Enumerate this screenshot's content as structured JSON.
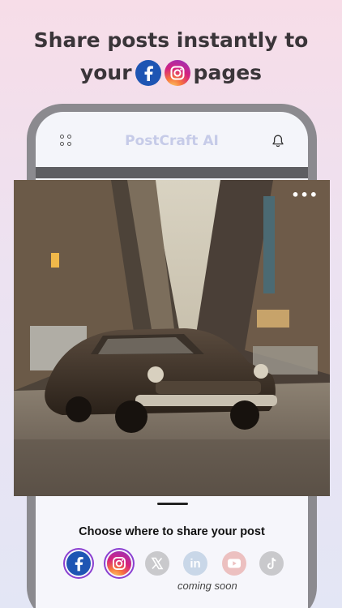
{
  "headline": {
    "line1": "Share posts instantly to",
    "line2_prefix": "your",
    "line2_suffix": "pages"
  },
  "app_bar": {
    "title": "PostCraft AI",
    "menu_icon": "grid-dots-icon",
    "notification_icon": "bell-icon"
  },
  "post": {
    "image_description_icon": "photo",
    "more_label": "•••"
  },
  "share_sheet": {
    "title": "Choose where to share your post",
    "coming_soon": "coming soon",
    "platforms": [
      {
        "name": "facebook",
        "label": "f",
        "selected": true
      },
      {
        "name": "instagram",
        "selected": true
      },
      {
        "name": "x"
      },
      {
        "name": "linkedin",
        "label": "in"
      },
      {
        "name": "youtube"
      },
      {
        "name": "tiktok"
      }
    ]
  },
  "colors": {
    "facebook": "#1e55b3",
    "selection_ring": "#8a3fd1",
    "app_title": "#c6cbe8",
    "disabled_icon": "#c9c9cc"
  }
}
